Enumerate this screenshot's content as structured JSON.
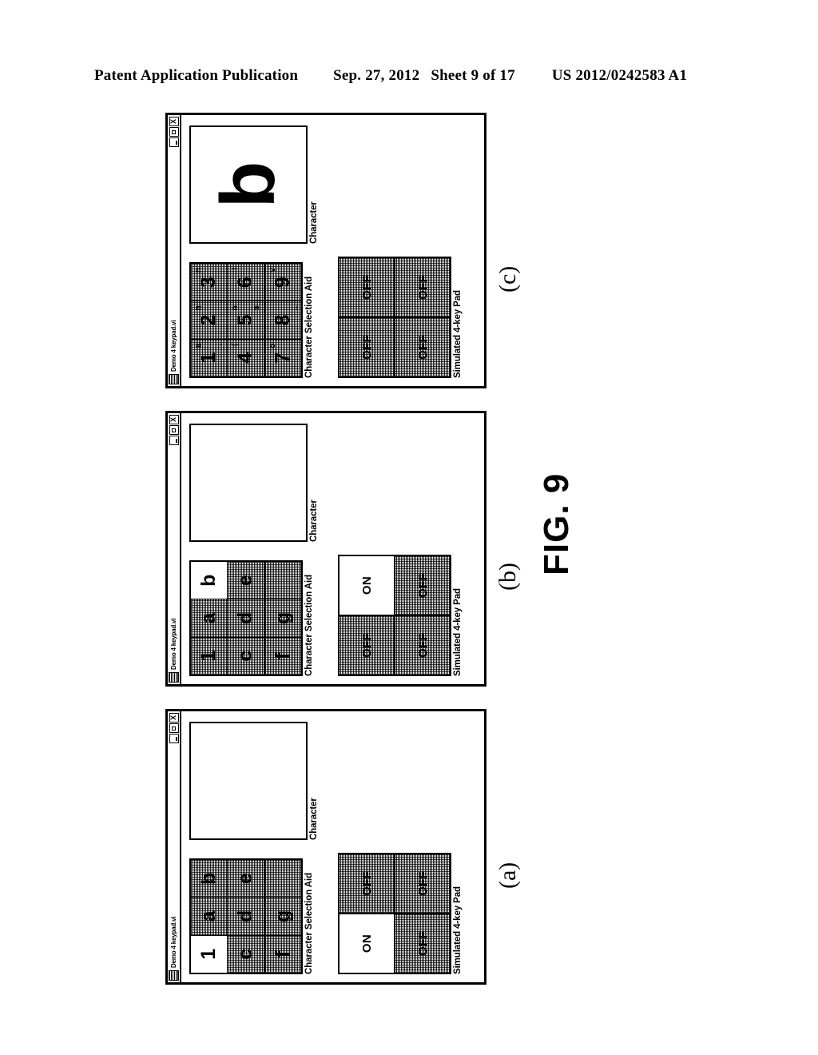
{
  "header": {
    "publication": "Patent Application Publication",
    "date": "Sep. 27, 2012",
    "sheet": "Sheet 9 of 17",
    "patent_number": "US 2012/0242583 A1"
  },
  "figure": {
    "caption": "FIG. 9"
  },
  "window_chrome": {
    "title": "Demo 4 keypad.vi",
    "minimize_label": "",
    "maximize_label": "",
    "close_label": "X"
  },
  "labels": {
    "selection_aid": "Character Selection Aid",
    "character": "Character",
    "keypad": "Simulated 4-key Pad"
  },
  "panels": [
    {
      "letter": "(a)",
      "selection_aid": {
        "cells": [
          {
            "main": "1",
            "sup": "",
            "sub": "",
            "state": "selected"
          },
          {
            "main": "a",
            "sup": "",
            "sub": "",
            "state": "normal"
          },
          {
            "main": "b",
            "sup": "",
            "sub": "",
            "state": "normal"
          },
          {
            "main": "c",
            "sup": "",
            "sub": "",
            "state": "normal"
          },
          {
            "main": "d",
            "sup": "",
            "sub": "",
            "state": "normal"
          },
          {
            "main": "e",
            "sup": "",
            "sub": "",
            "state": "normal"
          },
          {
            "main": "f",
            "sup": "",
            "sub": "",
            "state": "normal"
          },
          {
            "main": "g",
            "sup": "",
            "sub": "",
            "state": "normal"
          },
          {
            "main": "",
            "sup": "",
            "sub": "",
            "state": "normal"
          }
        ]
      },
      "character": "",
      "keypad": {
        "keys": [
          {
            "label": "ON",
            "state": "on"
          },
          {
            "label": "OFF",
            "state": "off"
          },
          {
            "label": "OFF",
            "state": "off"
          },
          {
            "label": "OFF",
            "state": "off"
          }
        ]
      }
    },
    {
      "letter": "(b)",
      "selection_aid": {
        "cells": [
          {
            "main": "1",
            "sup": "",
            "sub": "",
            "state": "normal"
          },
          {
            "main": "a",
            "sup": "",
            "sub": "",
            "state": "normal"
          },
          {
            "main": "b",
            "sup": "",
            "sub": "",
            "state": "selected"
          },
          {
            "main": "c",
            "sup": "",
            "sub": "",
            "state": "normal"
          },
          {
            "main": "d",
            "sup": "",
            "sub": "",
            "state": "normal"
          },
          {
            "main": "e",
            "sup": "",
            "sub": "",
            "state": "normal"
          },
          {
            "main": "f",
            "sup": "",
            "sub": "",
            "state": "normal"
          },
          {
            "main": "g",
            "sup": "",
            "sub": "",
            "state": "normal"
          },
          {
            "main": "",
            "sup": "",
            "sub": "",
            "state": "normal"
          }
        ]
      },
      "character": "",
      "keypad": {
        "keys": [
          {
            "label": "OFF",
            "state": "off"
          },
          {
            "label": "ON",
            "state": "on"
          },
          {
            "label": "OFF",
            "state": "off"
          },
          {
            "label": "OFF",
            "state": "off"
          }
        ]
      }
    },
    {
      "letter": "(c)",
      "selection_aid": {
        "cells": [
          {
            "main": "1",
            "sup": "a",
            "sub": ".",
            "state": "normal"
          },
          {
            "main": "2",
            "sup": "n",
            "sub": "",
            "state": "normal"
          },
          {
            "main": "3",
            "sup": "n",
            "sub": "",
            "state": "normal"
          },
          {
            "main": "4",
            "sup": "(",
            "sub": "",
            "state": "normal"
          },
          {
            "main": "5",
            "sup": "o",
            "sub": "s",
            "state": "normal"
          },
          {
            "main": "6",
            "sup": "l",
            "sub": "",
            "state": "normal"
          },
          {
            "main": "7",
            "sup": "o",
            "sub": "",
            "state": "normal"
          },
          {
            "main": "8",
            "sup": "",
            "sub": "_",
            "state": "normal"
          },
          {
            "main": "9",
            "sup": "v",
            "sub": "",
            "state": "normal"
          }
        ]
      },
      "character": "b",
      "keypad": {
        "keys": [
          {
            "label": "OFF",
            "state": "off"
          },
          {
            "label": "OFF",
            "state": "off"
          },
          {
            "label": "OFF",
            "state": "off"
          },
          {
            "label": "OFF",
            "state": "off"
          }
        ]
      }
    }
  ]
}
